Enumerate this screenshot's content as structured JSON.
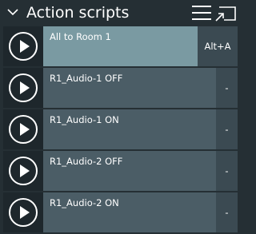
{
  "header": {
    "title": "Action scripts"
  },
  "scripts": [
    {
      "name": "All to Room 1",
      "hotkey": "Alt+A",
      "selected": true
    },
    {
      "name": "R1_Audio-1 OFF",
      "hotkey": "-",
      "selected": false
    },
    {
      "name": "R1_Audio-1 ON",
      "hotkey": "-",
      "selected": false
    },
    {
      "name": "R1_Audio-2 OFF",
      "hotkey": "-",
      "selected": false
    },
    {
      "name": "R1_Audio-2 ON",
      "hotkey": "-",
      "selected": false
    }
  ],
  "colors": {
    "background": "#252f34",
    "row": "#4b5d66",
    "row_selected": "#7a9aa2",
    "play_button": "#1e272c"
  },
  "icons": {
    "collapse": "chevron-down-icon",
    "menu": "hamburger-menu-icon",
    "popout": "popout-window-icon",
    "play": "play-icon"
  }
}
